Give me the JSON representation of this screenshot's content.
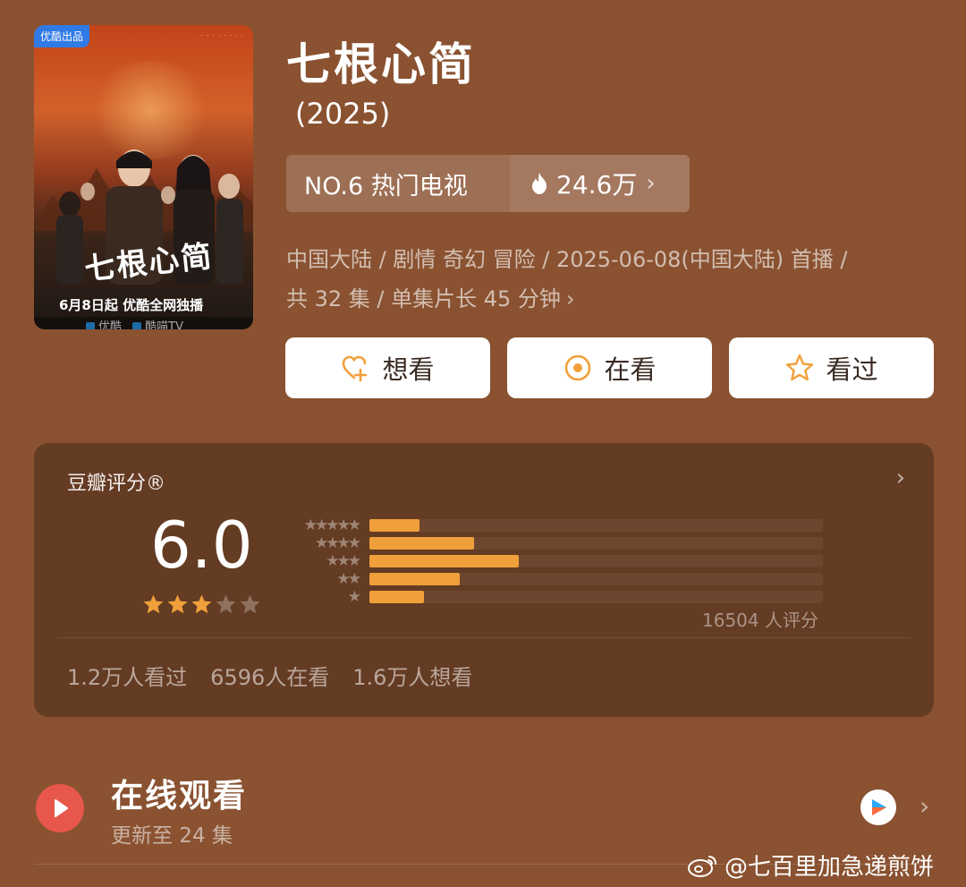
{
  "poster": {
    "badge": "优酷出品",
    "title": "七根心简",
    "date_line": "6月8日起 优酷全网独播",
    "platforms": [
      "优酷",
      "酷喵TV"
    ]
  },
  "show": {
    "title": "七根心简",
    "year": "(2025)"
  },
  "rank": {
    "label": "NO.6 热门电视",
    "heat": "24.6万",
    "flame_icon": "flame-icon",
    "chevron": "›"
  },
  "meta": {
    "line1": "中国大陆 / 剧情 奇幻 冒险 / 2025-06-08(中国大陆) 首播 /",
    "line2": "共 32 集 / 单集片长 45 分钟",
    "chevron": "›"
  },
  "actions": [
    {
      "label": "想看",
      "icon": "heart-plus-icon"
    },
    {
      "label": "在看",
      "icon": "target-circle-icon"
    },
    {
      "label": "看过",
      "icon": "star-outline-icon"
    }
  ],
  "rating": {
    "header": "豆瓣评分®",
    "score": "6.0",
    "stars_filled": 3,
    "stars_total": 5,
    "star_labels": [
      "★★★★★",
      "★★★★",
      "★★★",
      "★★",
      "★"
    ],
    "distribution": [
      0.11,
      0.23,
      0.33,
      0.2,
      0.12
    ],
    "count": "16504 人评分",
    "stats": [
      "1.2万人看过",
      "6596人在看",
      "1.6万人想看"
    ],
    "accent_color": "#f0a03a"
  },
  "online": {
    "title": "在线观看",
    "subtitle": "更新至 24 集",
    "provider_icon": "youku-logo-icon",
    "chevron": "›"
  },
  "watermark": {
    "text": "@七百里加急递煎饼",
    "icon": "weibo-icon"
  }
}
